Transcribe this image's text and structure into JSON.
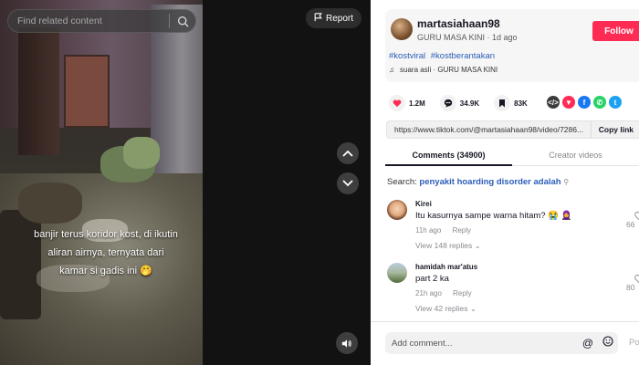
{
  "search": {
    "placeholder": "Find related content"
  },
  "video": {
    "report_label": "Report",
    "caption": "banjir terus koridor kost, di ikutin aliran airnya, ternyata dari kamar si gadis ini 🤭"
  },
  "author": {
    "username": "martasiahaan98",
    "nickname": "GURU  MASA  KINI",
    "date": "1d ago",
    "follow_label": "Follow"
  },
  "hashtags": [
    "#kostviral",
    "#kostberantakan"
  ],
  "music": "suara asli · GURU  MASA  KINI",
  "stats": {
    "likes": "1.2M",
    "comments": "34.9K",
    "saves": "83K"
  },
  "share_icons": [
    "embed-icon",
    "send-icon",
    "facebook-icon",
    "whatsapp-icon",
    "twitter-icon"
  ],
  "link": {
    "url": "https://www.tiktok.com/@martasiahaan98/video/7286...",
    "copy_label": "Copy link"
  },
  "tabs": [
    {
      "label": "Comments (34900)",
      "active": true
    },
    {
      "label": "Creator videos",
      "active": false
    }
  ],
  "related_search": {
    "prefix": "Search:",
    "query": "penyakit hoarding disorder adalah"
  },
  "comments": [
    {
      "user": "Kirei",
      "text": "Itu kasurnya sampe warna hitam? 😭 🧕",
      "time": "11h ago",
      "reply": "Reply",
      "views": "View 148 replies",
      "likes": "66"
    },
    {
      "user": "hamidah mar'atus",
      "text": "part 2 ka",
      "time": "21h ago",
      "reply": "Reply",
      "views": "View 42 replies",
      "likes": "80"
    }
  ],
  "comment_bar": {
    "placeholder": "Add comment...",
    "post_label": "Po"
  },
  "colors": {
    "accent": "#fe2c55",
    "link": "#2b5db9",
    "stage": "#121212"
  }
}
